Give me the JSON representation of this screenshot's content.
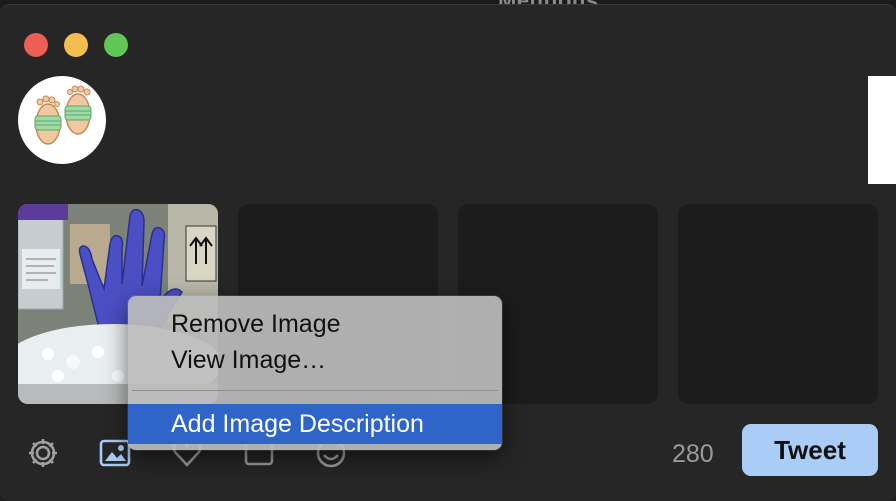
{
  "background": {
    "title": "Mentions"
  },
  "window": {
    "traffic_lights": [
      "close",
      "minimize",
      "zoom"
    ]
  },
  "composer": {
    "avatar": "feet-with-masks-icon",
    "media_slots": [
      {
        "name": "attached-photo-gloved-hand",
        "filled": true
      },
      {
        "name": "empty-slot",
        "filled": false
      },
      {
        "name": "empty-slot",
        "filled": false
      },
      {
        "name": "empty-slot",
        "filled": false
      }
    ]
  },
  "toolbar": {
    "icons": [
      "gear-icon",
      "image-icon",
      "heart-icon",
      "gif-icon",
      "emoji-icon"
    ],
    "char_count": "280",
    "tweet_label": "Tweet"
  },
  "context_menu": {
    "items": [
      "Remove Image",
      "View Image…",
      "Add Image Description"
    ],
    "highlighted": "Add Image Description"
  },
  "colors": {
    "accent": "#2f64c8",
    "tweet_button": "#a9cdf6",
    "window_bg": "#262626"
  }
}
